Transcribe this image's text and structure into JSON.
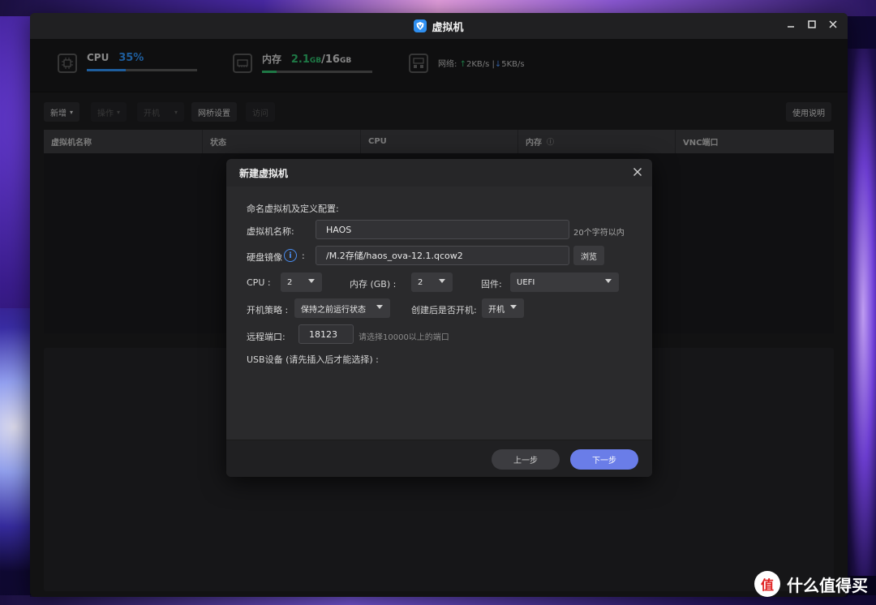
{
  "window": {
    "title": "虚拟机"
  },
  "stats": {
    "cpu": {
      "label": "CPU",
      "value": "35%",
      "fraction": 0.35,
      "color": "#2f8ff0"
    },
    "mem": {
      "label": "内存",
      "used": "2.1",
      "used_unit": "GB",
      "sep": "/",
      "total": "16",
      "total_unit": "GB",
      "fraction": 0.13,
      "color": "#2fb86a"
    },
    "net": {
      "label": "网络:",
      "up": "2KB/s",
      "sep": "|",
      "down": "5KB/s"
    }
  },
  "toolbar": {
    "new": "新增",
    "ops": "操作",
    "power": "开机",
    "bridge": "网桥设置",
    "visit": "访问",
    "help": "使用说明"
  },
  "table": {
    "columns": [
      "虚拟机名称",
      "状态",
      "CPU",
      "内存",
      "VNC端口"
    ]
  },
  "dialog": {
    "title": "新建虚拟机",
    "section": "命名虚拟机及定义配置:",
    "name_label": "虚拟机名称:",
    "name_value": "HAOS",
    "name_hint": "20个字符以内",
    "disk_label": "硬盘镜像",
    "disk_colon": ":",
    "disk_value": "/M.2存储/haos_ova-12.1.qcow2",
    "browse": "浏览",
    "cpu_label": "CPU :",
    "cpu_value": "2",
    "mem_label": "内存 (GB) :",
    "mem_value": "2",
    "firmware_label": "固件:",
    "firmware_value": "UEFI",
    "boot_policy_label": "开机策略 :",
    "boot_policy_value": "保持之前运行状态",
    "power_after_label": "创建后是否开机:",
    "power_after_value": "开机",
    "port_label": "远程端口:",
    "port_value": "18123",
    "port_hint": "请选择10000以上的端口",
    "usb_label": "USB设备 (请先插入后才能选择) :",
    "prev": "上一步",
    "next": "下一步"
  },
  "watermark": {
    "text": "什么值得买",
    "icon_text": "值"
  }
}
